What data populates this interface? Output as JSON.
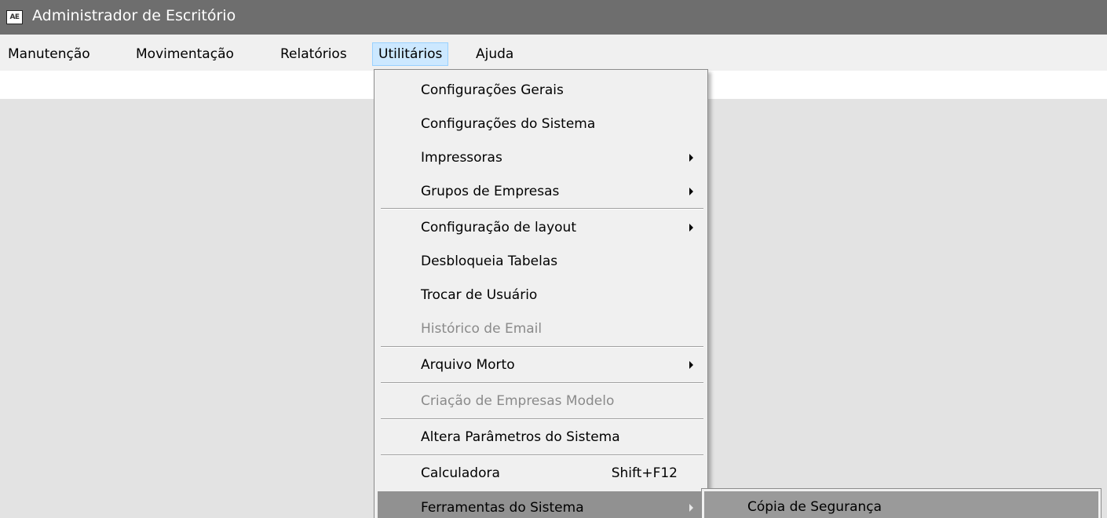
{
  "window": {
    "icon_text": "AE",
    "title": "Administrador de Escritório"
  },
  "menubar": {
    "items": [
      {
        "label": "Manutenção"
      },
      {
        "label": "Movimentação"
      },
      {
        "label": "Relatórios"
      },
      {
        "label": "Utilitários",
        "open": true
      },
      {
        "label": "Ajuda"
      }
    ]
  },
  "utilitarios_menu": {
    "items": [
      {
        "label": "Configurações Gerais"
      },
      {
        "label": "Configurações do Sistema"
      },
      {
        "label": "Impressoras",
        "submenu": true
      },
      {
        "label": "Grupos de Empresas",
        "submenu": true
      },
      {
        "label": "Configuração de layout",
        "submenu": true
      },
      {
        "label": "Desbloqueia Tabelas"
      },
      {
        "label": "Trocar de Usuário"
      },
      {
        "label": "Histórico de Email",
        "disabled": true
      },
      {
        "label": "Arquivo Morto",
        "submenu": true
      },
      {
        "label": "Criação de Empresas Modelo",
        "disabled": true
      },
      {
        "label": "Altera Parâmetros do Sistema"
      },
      {
        "label": "Calculadora",
        "shortcut": "Shift+F12"
      },
      {
        "label": "Ferramentas do Sistema",
        "submenu": true,
        "highlighted": true
      }
    ]
  },
  "ferramentas_submenu": {
    "items": [
      {
        "label": "Cópia de Segurança",
        "highlighted": true
      }
    ]
  },
  "colors": {
    "titlebar": "#6e6e6e",
    "menubar": "#f0f0f0",
    "open_menu_highlight": "#cce8ff",
    "item_highlight": "#919191",
    "disabled_text": "#8a8a8a",
    "workspace": "#e3e3e3"
  }
}
